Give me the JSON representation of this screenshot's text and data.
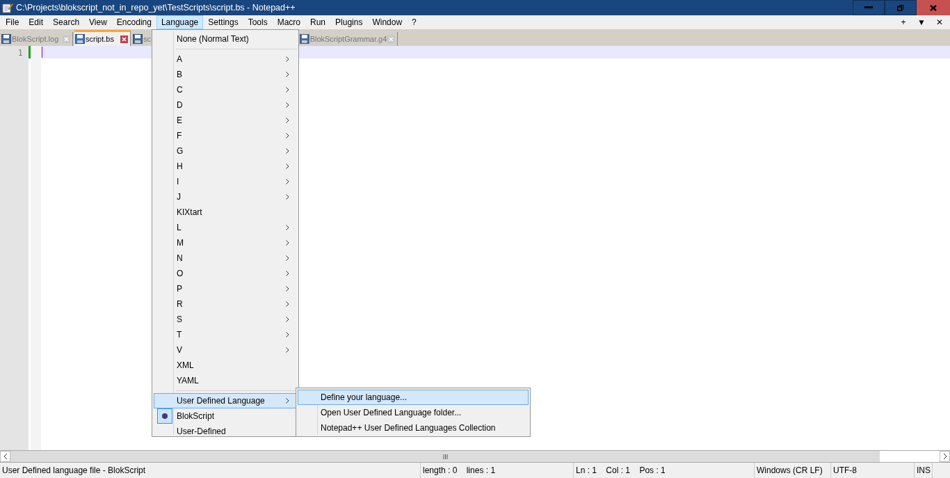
{
  "window": {
    "title": "C:\\Projects\\blokscript_not_in_repo_yet\\TestScripts\\script.bs - Notepad++"
  },
  "menu_bar": [
    {
      "label": "File",
      "selected": false
    },
    {
      "label": "Edit",
      "selected": false
    },
    {
      "label": "Search",
      "selected": false
    },
    {
      "label": "View",
      "selected": false
    },
    {
      "label": "Encoding",
      "selected": false
    },
    {
      "label": "Language",
      "selected": true
    },
    {
      "label": "Settings",
      "selected": false
    },
    {
      "label": "Tools",
      "selected": false
    },
    {
      "label": "Macro",
      "selected": false
    },
    {
      "label": "Run",
      "selected": false
    },
    {
      "label": "Plugins",
      "selected": false
    },
    {
      "label": "Window",
      "selected": false
    },
    {
      "label": "?",
      "selected": false
    }
  ],
  "menu_bar_right": [
    "+",
    "▼",
    "✕"
  ],
  "tabs": [
    {
      "label": "BlokScript.log",
      "selected": false
    },
    {
      "label": "script.bs",
      "selected": true
    },
    {
      "label": "sc",
      "selected": false
    },
    {
      "label": "BlokScriptGrammar.g4",
      "selected": false
    }
  ],
  "editor": {
    "line_numbers": [
      "1"
    ]
  },
  "language_menu": [
    {
      "kind": "item",
      "label": "None (Normal Text)",
      "submenu": false,
      "highlighted": false,
      "checked": false
    },
    {
      "kind": "separator"
    },
    {
      "kind": "item",
      "label": "A",
      "submenu": true,
      "highlighted": false,
      "checked": false
    },
    {
      "kind": "item",
      "label": "B",
      "submenu": true,
      "highlighted": false,
      "checked": false
    },
    {
      "kind": "item",
      "label": "C",
      "submenu": true,
      "highlighted": false,
      "checked": false
    },
    {
      "kind": "item",
      "label": "D",
      "submenu": true,
      "highlighted": false,
      "checked": false
    },
    {
      "kind": "item",
      "label": "E",
      "submenu": true,
      "highlighted": false,
      "checked": false
    },
    {
      "kind": "item",
      "label": "F",
      "submenu": true,
      "highlighted": false,
      "checked": false
    },
    {
      "kind": "item",
      "label": "G",
      "submenu": true,
      "highlighted": false,
      "checked": false
    },
    {
      "kind": "item",
      "label": "H",
      "submenu": true,
      "highlighted": false,
      "checked": false
    },
    {
      "kind": "item",
      "label": "I",
      "submenu": true,
      "highlighted": false,
      "checked": false
    },
    {
      "kind": "item",
      "label": "J",
      "submenu": true,
      "highlighted": false,
      "checked": false
    },
    {
      "kind": "item",
      "label": "KIXtart",
      "submenu": false,
      "highlighted": false,
      "checked": false
    },
    {
      "kind": "item",
      "label": "L",
      "submenu": true,
      "highlighted": false,
      "checked": false
    },
    {
      "kind": "item",
      "label": "M",
      "submenu": true,
      "highlighted": false,
      "checked": false
    },
    {
      "kind": "item",
      "label": "N",
      "submenu": true,
      "highlighted": false,
      "checked": false
    },
    {
      "kind": "item",
      "label": "O",
      "submenu": true,
      "highlighted": false,
      "checked": false
    },
    {
      "kind": "item",
      "label": "P",
      "submenu": true,
      "highlighted": false,
      "checked": false
    },
    {
      "kind": "item",
      "label": "R",
      "submenu": true,
      "highlighted": false,
      "checked": false
    },
    {
      "kind": "item",
      "label": "S",
      "submenu": true,
      "highlighted": false,
      "checked": false
    },
    {
      "kind": "item",
      "label": "T",
      "submenu": true,
      "highlighted": false,
      "checked": false
    },
    {
      "kind": "item",
      "label": "V",
      "submenu": true,
      "highlighted": false,
      "checked": false
    },
    {
      "kind": "item",
      "label": "XML",
      "submenu": false,
      "highlighted": false,
      "checked": false
    },
    {
      "kind": "item",
      "label": "YAML",
      "submenu": false,
      "highlighted": false,
      "checked": false
    },
    {
      "kind": "separator"
    },
    {
      "kind": "item",
      "label": "User Defined Language",
      "submenu": true,
      "highlighted": true,
      "checked": false
    },
    {
      "kind": "item",
      "label": "BlokScript",
      "submenu": false,
      "highlighted": false,
      "checked": true
    },
    {
      "kind": "item",
      "label": "User-Defined",
      "submenu": false,
      "highlighted": false,
      "checked": false
    }
  ],
  "submenu": [
    {
      "label": "Define your language...",
      "highlighted": true
    },
    {
      "label": "Open User Defined Language folder...",
      "highlighted": false
    },
    {
      "label": "Notepad++ User Defined Languages Collection",
      "highlighted": false
    }
  ],
  "status_bar": [
    "User Defined language file - BlokScript",
    "length : 0    lines : 1",
    "Ln : 1    Col : 1    Pos : 1",
    "Windows (CR LF)",
    "UTF-8",
    "INS"
  ]
}
